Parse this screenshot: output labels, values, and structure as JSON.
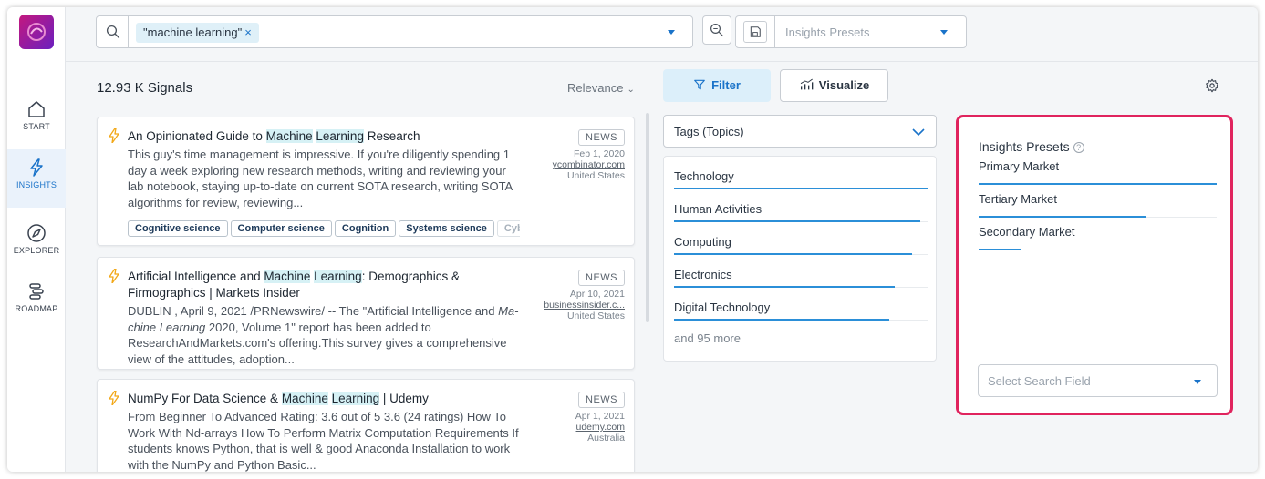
{
  "sidebar": {
    "items": [
      {
        "label": "START",
        "icon": "home-icon"
      },
      {
        "label": "INSIGHTS",
        "icon": "bolt-icon"
      },
      {
        "label": "EXPLORER",
        "icon": "compass-icon"
      },
      {
        "label": "ROADMAP",
        "icon": "roadmap-icon"
      }
    ]
  },
  "search": {
    "chip_label": "\"machine learning\"",
    "chip_remove": "×"
  },
  "presets_dropdown": {
    "placeholder": "Insights Presets"
  },
  "results": {
    "count": "12.93 K Signals",
    "sort_label": "Relevance"
  },
  "signals": [
    {
      "title_pre": "An Opinionated Guide to ",
      "title_hl1": "Machine",
      "title_mid": " ",
      "title_hl2": "Learning",
      "title_post": " Research",
      "body": "This guy's time management is impressive. If you're diligently spending 1 day a week exploring new research methods, writing and reviewing your lab notebook, staying up-to-date on current SOTA research, writing SOTA algorithms for review, reviewing...",
      "badge": "NEWS",
      "date": "Feb 1, 2020",
      "source": "ycombinator.com",
      "location": "United States",
      "tags": [
        "Cognitive science",
        "Computer science",
        "Cognition",
        "Systems science",
        "Cyber"
      ]
    },
    {
      "title_pre": "Artificial Intelligence and ",
      "title_hl1": "Machine",
      "title_mid": " ",
      "title_hl2": "Learning",
      "title_post": ": Demographics & Firmographics | Markets Insider",
      "body_pre": "DUBLIN , April 9, 2021 /PRNewswire/ -- The \"Artificial Intelligence and ",
      "body_em": "Ma-chine Learning",
      "body_post": " 2020, Volume 1\" report has been added to ResearchAndMarkets.com's offering.This survey gives a comprehensive view of the attitudes, adoption...",
      "badge": "NEWS",
      "date": "Apr 10, 2021",
      "source": "businessinsider.c...",
      "location": "United States"
    },
    {
      "title_pre": "NumPy For Data Science & ",
      "title_hl1": "Machine",
      "title_mid": " ",
      "title_hl2": "Learning",
      "title_post": " | Udemy",
      "body": "From Beginner To Advanced Rating: 3.6 out of 5 3.6 (24 ratings) How To Work With Nd-arrays How To Perform Matrix Computation Requirements If students knows Python, that is well & good Anaconda Installation to work with the NumPy and Python Basic...",
      "badge": "NEWS",
      "date": "Apr 1, 2021",
      "source": "udemy.com",
      "location": "Australia"
    }
  ],
  "toolbar": {
    "filter_label": "Filter",
    "visualize_label": "Visualize"
  },
  "tags_panel": {
    "dropdown_label": "Tags (Topics)",
    "items": [
      {
        "label": "Technology",
        "level": 1.0
      },
      {
        "label": "Human Activities",
        "level": 0.97
      },
      {
        "label": "Computing",
        "level": 0.94
      },
      {
        "label": "Electronics",
        "level": 0.87
      },
      {
        "label": "Digital Technology",
        "level": 0.85
      }
    ],
    "more_label": "and 95 more"
  },
  "presets_panel": {
    "title": "Insights Presets",
    "help": "?",
    "items": [
      {
        "label": "Primary Market",
        "level": 1.0
      },
      {
        "label": "Tertiary Market",
        "level": 0.7
      },
      {
        "label": "Secondary Market",
        "level": 0.18
      }
    ],
    "select_placeholder": "Select Search Field"
  },
  "colors": {
    "accent": "#1a73c9",
    "highlight": "#d6f1f5",
    "panel_border": "#e0245e",
    "bar": "#2b8fd8"
  }
}
